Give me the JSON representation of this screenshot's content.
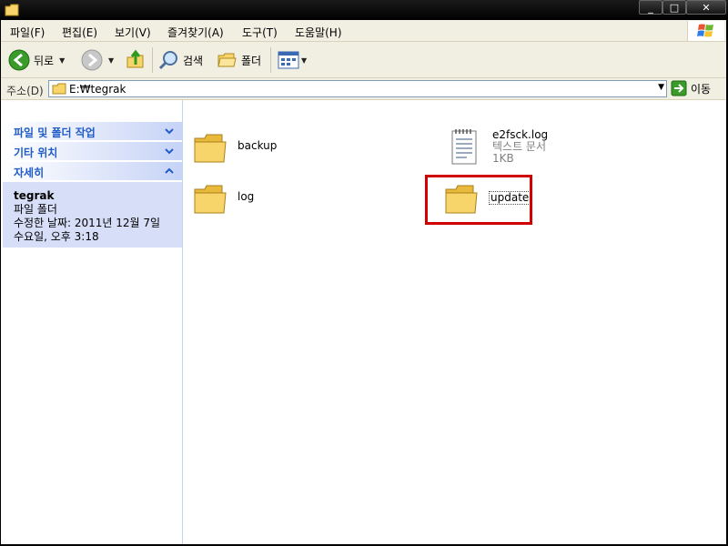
{
  "window": {
    "controls": {
      "minimize": "_",
      "maximize": "□",
      "close": "✕"
    }
  },
  "menu": [
    "파일(F)",
    "편집(E)",
    "보기(V)",
    "즐겨찾기(A)",
    "도구(T)",
    "도움말(H)"
  ],
  "toolbar": {
    "back_label": "뒤로",
    "search_label": "검색",
    "folders_label": "폴더"
  },
  "address": {
    "label": "주소(D)",
    "value": "E:₩tegrak",
    "go_label": "이동"
  },
  "taskpane": {
    "sections": [
      {
        "title": "파일 및 폴더 작업",
        "expanded": false
      },
      {
        "title": "기타 위치",
        "expanded": false
      },
      {
        "title": "자세히",
        "expanded": true
      }
    ],
    "details": {
      "name": "tegrak",
      "type": "파일 폴더",
      "modified_line1": "수정한 날짜: 2011년 12월 7일",
      "modified_line2": "수요일, 오후 3:18"
    }
  },
  "files": [
    {
      "name": "backup",
      "kind": "folder"
    },
    {
      "name": "e2fsck.log",
      "kind": "text",
      "type": "텍스트 문서",
      "size": "1KB"
    },
    {
      "name": "log",
      "kind": "folder"
    },
    {
      "name": "update",
      "kind": "folder",
      "highlighted": true
    }
  ],
  "colors": {
    "highlight": "#d10000",
    "pane_head_text": "#215dc6",
    "folder_yellow": "#f7d56b"
  }
}
